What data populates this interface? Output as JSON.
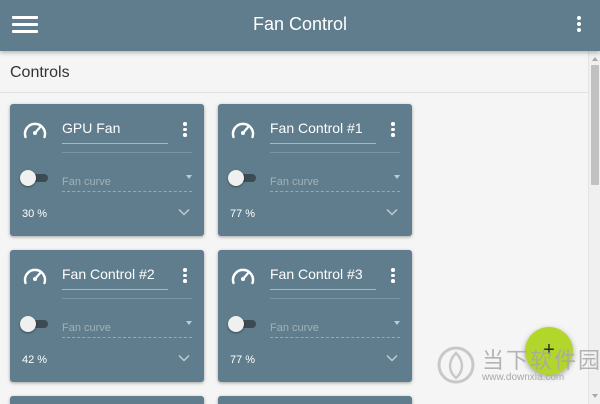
{
  "app_bar": {
    "title": "Fan Control",
    "menu_icon": "hamburger-menu-icon",
    "more_icon": "more-vert-icon"
  },
  "section": {
    "title": "Controls"
  },
  "cards": [
    {
      "name": "GPU Fan",
      "enabled": false,
      "curve_placeholder": "Fan curve",
      "speed": "30 %",
      "icon": "gauge-icon"
    },
    {
      "name": "Fan Control #1",
      "enabled": false,
      "curve_placeholder": "Fan curve",
      "speed": "77 %",
      "icon": "gauge-icon"
    },
    {
      "name": "Fan Control #2",
      "enabled": false,
      "curve_placeholder": "Fan curve",
      "speed": "42 %",
      "icon": "gauge-icon"
    },
    {
      "name": "Fan Control #3",
      "enabled": false,
      "curve_placeholder": "Fan curve",
      "speed": "77 %",
      "icon": "gauge-icon"
    }
  ],
  "fab": {
    "label": "+",
    "icon": "add-icon"
  },
  "watermark": {
    "text": "当下软件园",
    "url": "www.downxia.com"
  },
  "colors": {
    "primary": "#5f7d8c",
    "accent": "#b2d62a",
    "background": "#f5f5f5"
  }
}
